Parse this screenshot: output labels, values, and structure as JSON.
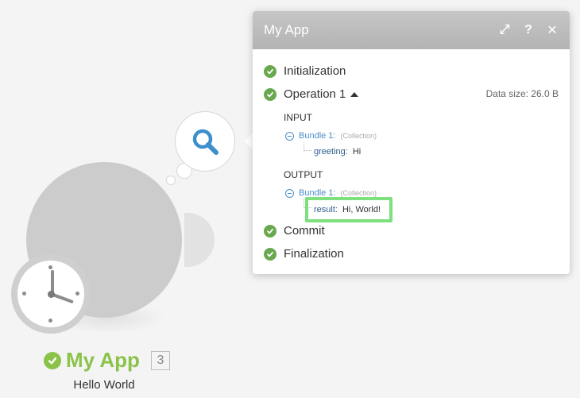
{
  "module": {
    "name": "My App",
    "badge": "3",
    "subtitle": "Hello World",
    "accent_color": "#8bc34a",
    "bubble_icon": "search-icon"
  },
  "panel": {
    "title": "My App",
    "tools": [
      {
        "name": "expand-icon",
        "glyph": "⤢"
      },
      {
        "name": "help-icon",
        "glyph": "?"
      },
      {
        "name": "close-icon",
        "glyph": "✕"
      }
    ],
    "steps": [
      {
        "label": "Initialization"
      },
      {
        "label": "Operation 1"
      },
      {
        "label": "Commit"
      },
      {
        "label": "Finalization"
      }
    ],
    "data_size": "Data size: 26.0 B",
    "input": {
      "section": "INPUT",
      "bundle": "Bundle 1:",
      "bundle_type": "(Collection)",
      "key": "greeting:",
      "value": "Hi"
    },
    "output": {
      "section": "OUTPUT",
      "bundle": "Bundle 1:",
      "bundle_type": "(Collection)",
      "key": "result:",
      "value": "Hi, World!"
    },
    "status_color": "#6aa84f",
    "highlight_color": "#7ee07e"
  }
}
